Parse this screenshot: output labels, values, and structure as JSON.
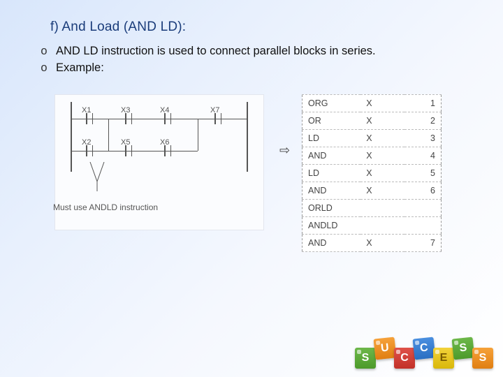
{
  "title": "f) And Load (AND LD):",
  "bullets": {
    "marker": "o",
    "items": [
      "AND LD instruction is used to connect parallel blocks in series.",
      "Example:"
    ]
  },
  "ladder": {
    "labels": {
      "x1": "X1",
      "x2": "X2",
      "x3": "X3",
      "x4": "X4",
      "x5": "X5",
      "x6": "X6",
      "x7": "X7"
    },
    "annotation": "Must use ANDLD instruction"
  },
  "arrow_glyph": "⇨",
  "table": {
    "rows": [
      {
        "op": "ORG",
        "a": "X",
        "n": "1"
      },
      {
        "op": "OR",
        "a": "X",
        "n": "2"
      },
      {
        "op": "LD",
        "a": "X",
        "n": "3"
      },
      {
        "op": "AND",
        "a": "X",
        "n": "4"
      },
      {
        "op": "LD",
        "a": "X",
        "n": "5"
      },
      {
        "op": "AND",
        "a": "X",
        "n": "6"
      },
      {
        "op": "ORLD",
        "a": "",
        "n": ""
      },
      {
        "op": "ANDLD",
        "a": "",
        "n": ""
      },
      {
        "op": "AND",
        "a": "X",
        "n": "7"
      }
    ]
  },
  "blocks": {
    "letters": [
      "S",
      "U",
      "C",
      "C",
      "E",
      "S",
      "S"
    ]
  }
}
